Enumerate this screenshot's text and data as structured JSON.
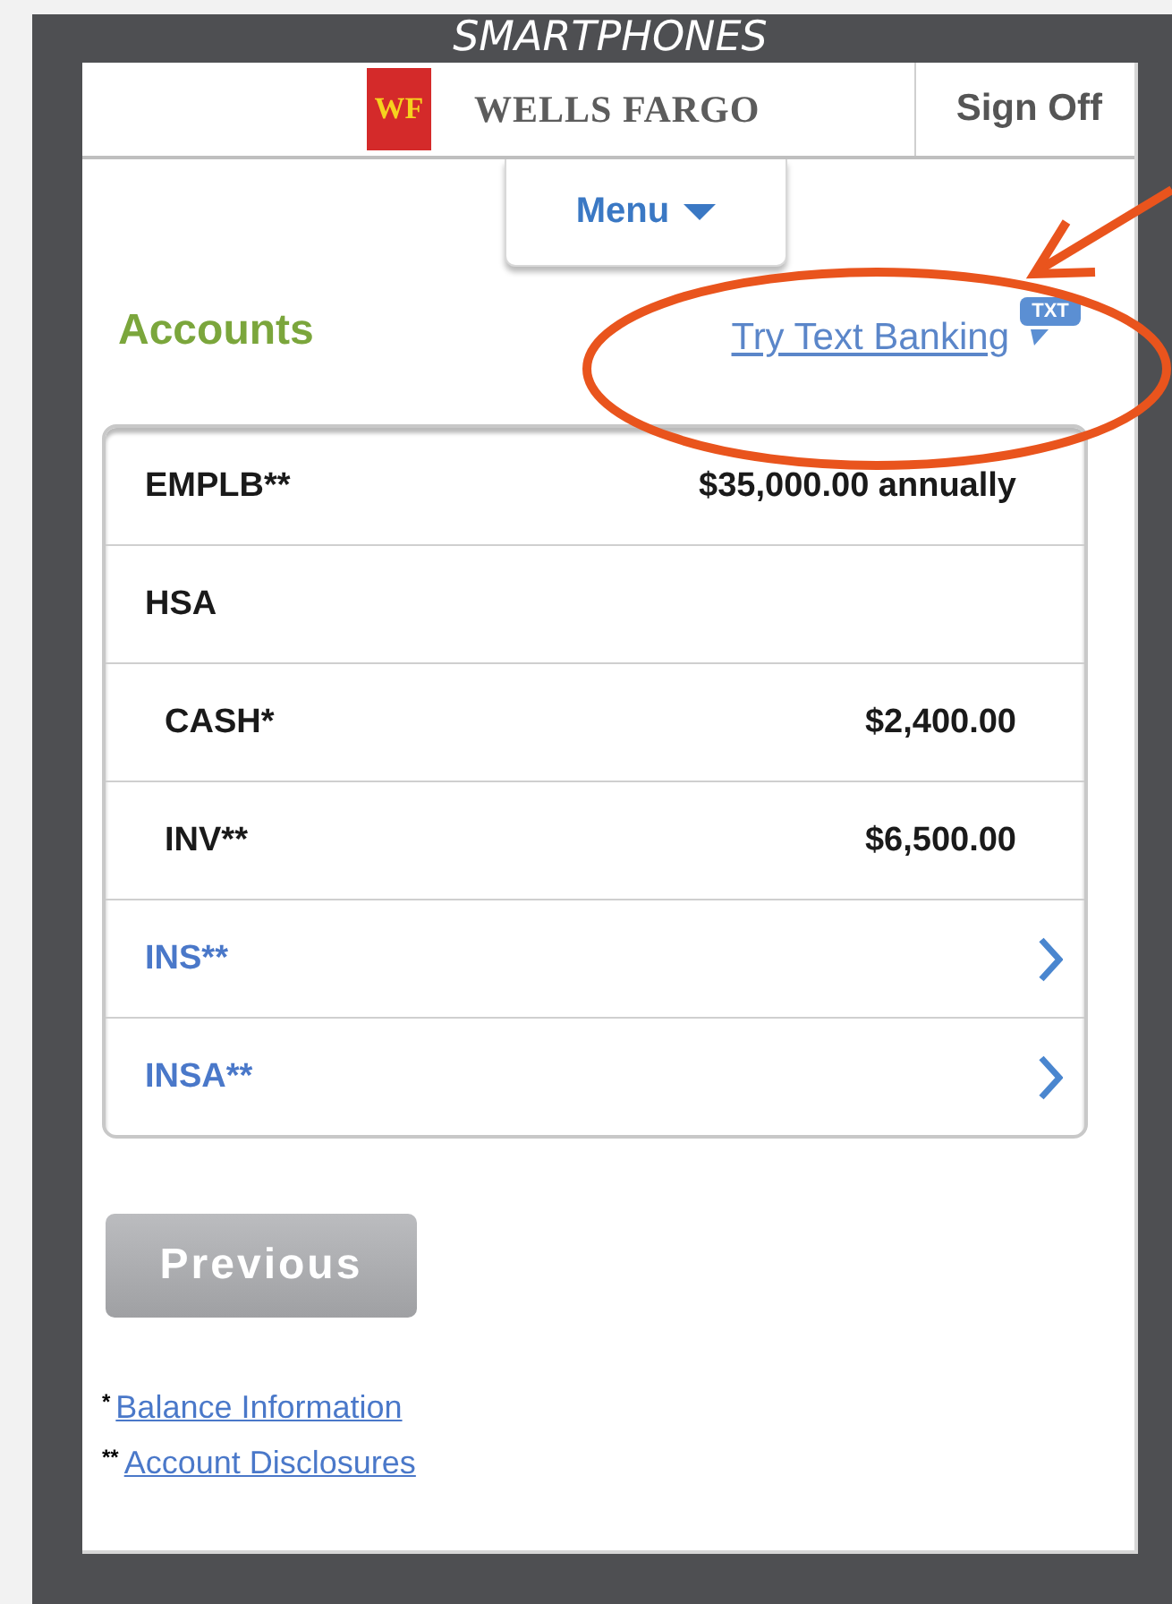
{
  "frame_title": "SMARTPHONES",
  "header": {
    "logo_mark": "WF",
    "brand": "WELLS FARGO",
    "sign_off": "Sign Off"
  },
  "menu": {
    "label": "Menu"
  },
  "section": {
    "title": "Accounts",
    "link": "Try Text Banking",
    "badge": "TXT"
  },
  "accounts": [
    {
      "kind": "value",
      "name": "EMPLB**",
      "amount": "$35,000.00 annually"
    },
    {
      "kind": "group",
      "name": "HSA",
      "children": [
        {
          "kind": "value",
          "name": "CASH*",
          "amount": "$2,400.00"
        },
        {
          "kind": "value",
          "name": "INV**",
          "amount": "$6,500.00"
        }
      ]
    },
    {
      "kind": "link",
      "name": "INS**"
    },
    {
      "kind": "link",
      "name": "INSA**"
    }
  ],
  "previous_button": "Previous",
  "footnotes": [
    {
      "mark": "*",
      "link": "Balance Information"
    },
    {
      "mark": "**",
      "link": "Account Disclosures"
    }
  ]
}
